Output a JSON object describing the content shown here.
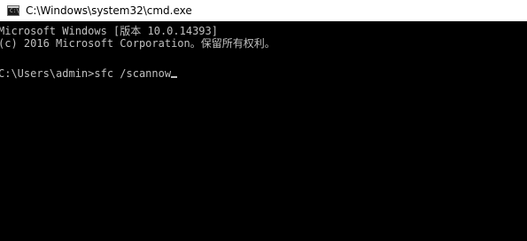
{
  "window": {
    "title": "C:\\Windows\\system32\\cmd.exe",
    "icon": "cmd-console-icon",
    "icon_glyph": "C:\\"
  },
  "console": {
    "lines": [
      "Microsoft Windows [版本 10.0.14393]",
      "(c) 2016 Microsoft Corporation。保留所有权利。",
      "C:\\Users\\admin>sfc /scannow"
    ],
    "text_color": "#c0c0c0",
    "background_color": "#000000"
  }
}
